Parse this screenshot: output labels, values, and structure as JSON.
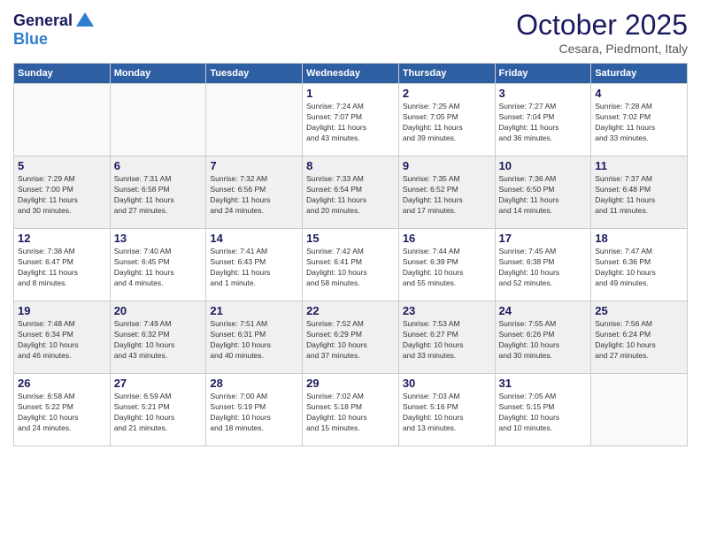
{
  "header": {
    "logo_line1": "General",
    "logo_line2": "Blue",
    "month": "October 2025",
    "location": "Cesara, Piedmont, Italy"
  },
  "weekdays": [
    "Sunday",
    "Monday",
    "Tuesday",
    "Wednesday",
    "Thursday",
    "Friday",
    "Saturday"
  ],
  "weeks": [
    [
      {
        "day": "",
        "info": ""
      },
      {
        "day": "",
        "info": ""
      },
      {
        "day": "",
        "info": ""
      },
      {
        "day": "1",
        "info": "Sunrise: 7:24 AM\nSunset: 7:07 PM\nDaylight: 11 hours\nand 43 minutes."
      },
      {
        "day": "2",
        "info": "Sunrise: 7:25 AM\nSunset: 7:05 PM\nDaylight: 11 hours\nand 39 minutes."
      },
      {
        "day": "3",
        "info": "Sunrise: 7:27 AM\nSunset: 7:04 PM\nDaylight: 11 hours\nand 36 minutes."
      },
      {
        "day": "4",
        "info": "Sunrise: 7:28 AM\nSunset: 7:02 PM\nDaylight: 11 hours\nand 33 minutes."
      }
    ],
    [
      {
        "day": "5",
        "info": "Sunrise: 7:29 AM\nSunset: 7:00 PM\nDaylight: 11 hours\nand 30 minutes."
      },
      {
        "day": "6",
        "info": "Sunrise: 7:31 AM\nSunset: 6:58 PM\nDaylight: 11 hours\nand 27 minutes."
      },
      {
        "day": "7",
        "info": "Sunrise: 7:32 AM\nSunset: 6:56 PM\nDaylight: 11 hours\nand 24 minutes."
      },
      {
        "day": "8",
        "info": "Sunrise: 7:33 AM\nSunset: 6:54 PM\nDaylight: 11 hours\nand 20 minutes."
      },
      {
        "day": "9",
        "info": "Sunrise: 7:35 AM\nSunset: 6:52 PM\nDaylight: 11 hours\nand 17 minutes."
      },
      {
        "day": "10",
        "info": "Sunrise: 7:36 AM\nSunset: 6:50 PM\nDaylight: 11 hours\nand 14 minutes."
      },
      {
        "day": "11",
        "info": "Sunrise: 7:37 AM\nSunset: 6:48 PM\nDaylight: 11 hours\nand 11 minutes."
      }
    ],
    [
      {
        "day": "12",
        "info": "Sunrise: 7:38 AM\nSunset: 6:47 PM\nDaylight: 11 hours\nand 8 minutes."
      },
      {
        "day": "13",
        "info": "Sunrise: 7:40 AM\nSunset: 6:45 PM\nDaylight: 11 hours\nand 4 minutes."
      },
      {
        "day": "14",
        "info": "Sunrise: 7:41 AM\nSunset: 6:43 PM\nDaylight: 11 hours\nand 1 minute."
      },
      {
        "day": "15",
        "info": "Sunrise: 7:42 AM\nSunset: 6:41 PM\nDaylight: 10 hours\nand 58 minutes."
      },
      {
        "day": "16",
        "info": "Sunrise: 7:44 AM\nSunset: 6:39 PM\nDaylight: 10 hours\nand 55 minutes."
      },
      {
        "day": "17",
        "info": "Sunrise: 7:45 AM\nSunset: 6:38 PM\nDaylight: 10 hours\nand 52 minutes."
      },
      {
        "day": "18",
        "info": "Sunrise: 7:47 AM\nSunset: 6:36 PM\nDaylight: 10 hours\nand 49 minutes."
      }
    ],
    [
      {
        "day": "19",
        "info": "Sunrise: 7:48 AM\nSunset: 6:34 PM\nDaylight: 10 hours\nand 46 minutes."
      },
      {
        "day": "20",
        "info": "Sunrise: 7:49 AM\nSunset: 6:32 PM\nDaylight: 10 hours\nand 43 minutes."
      },
      {
        "day": "21",
        "info": "Sunrise: 7:51 AM\nSunset: 6:31 PM\nDaylight: 10 hours\nand 40 minutes."
      },
      {
        "day": "22",
        "info": "Sunrise: 7:52 AM\nSunset: 6:29 PM\nDaylight: 10 hours\nand 37 minutes."
      },
      {
        "day": "23",
        "info": "Sunrise: 7:53 AM\nSunset: 6:27 PM\nDaylight: 10 hours\nand 33 minutes."
      },
      {
        "day": "24",
        "info": "Sunrise: 7:55 AM\nSunset: 6:26 PM\nDaylight: 10 hours\nand 30 minutes."
      },
      {
        "day": "25",
        "info": "Sunrise: 7:56 AM\nSunset: 6:24 PM\nDaylight: 10 hours\nand 27 minutes."
      }
    ],
    [
      {
        "day": "26",
        "info": "Sunrise: 6:58 AM\nSunset: 5:22 PM\nDaylight: 10 hours\nand 24 minutes."
      },
      {
        "day": "27",
        "info": "Sunrise: 6:59 AM\nSunset: 5:21 PM\nDaylight: 10 hours\nand 21 minutes."
      },
      {
        "day": "28",
        "info": "Sunrise: 7:00 AM\nSunset: 5:19 PM\nDaylight: 10 hours\nand 18 minutes."
      },
      {
        "day": "29",
        "info": "Sunrise: 7:02 AM\nSunset: 5:18 PM\nDaylight: 10 hours\nand 15 minutes."
      },
      {
        "day": "30",
        "info": "Sunrise: 7:03 AM\nSunset: 5:16 PM\nDaylight: 10 hours\nand 13 minutes."
      },
      {
        "day": "31",
        "info": "Sunrise: 7:05 AM\nSunset: 5:15 PM\nDaylight: 10 hours\nand 10 minutes."
      },
      {
        "day": "",
        "info": ""
      }
    ]
  ]
}
